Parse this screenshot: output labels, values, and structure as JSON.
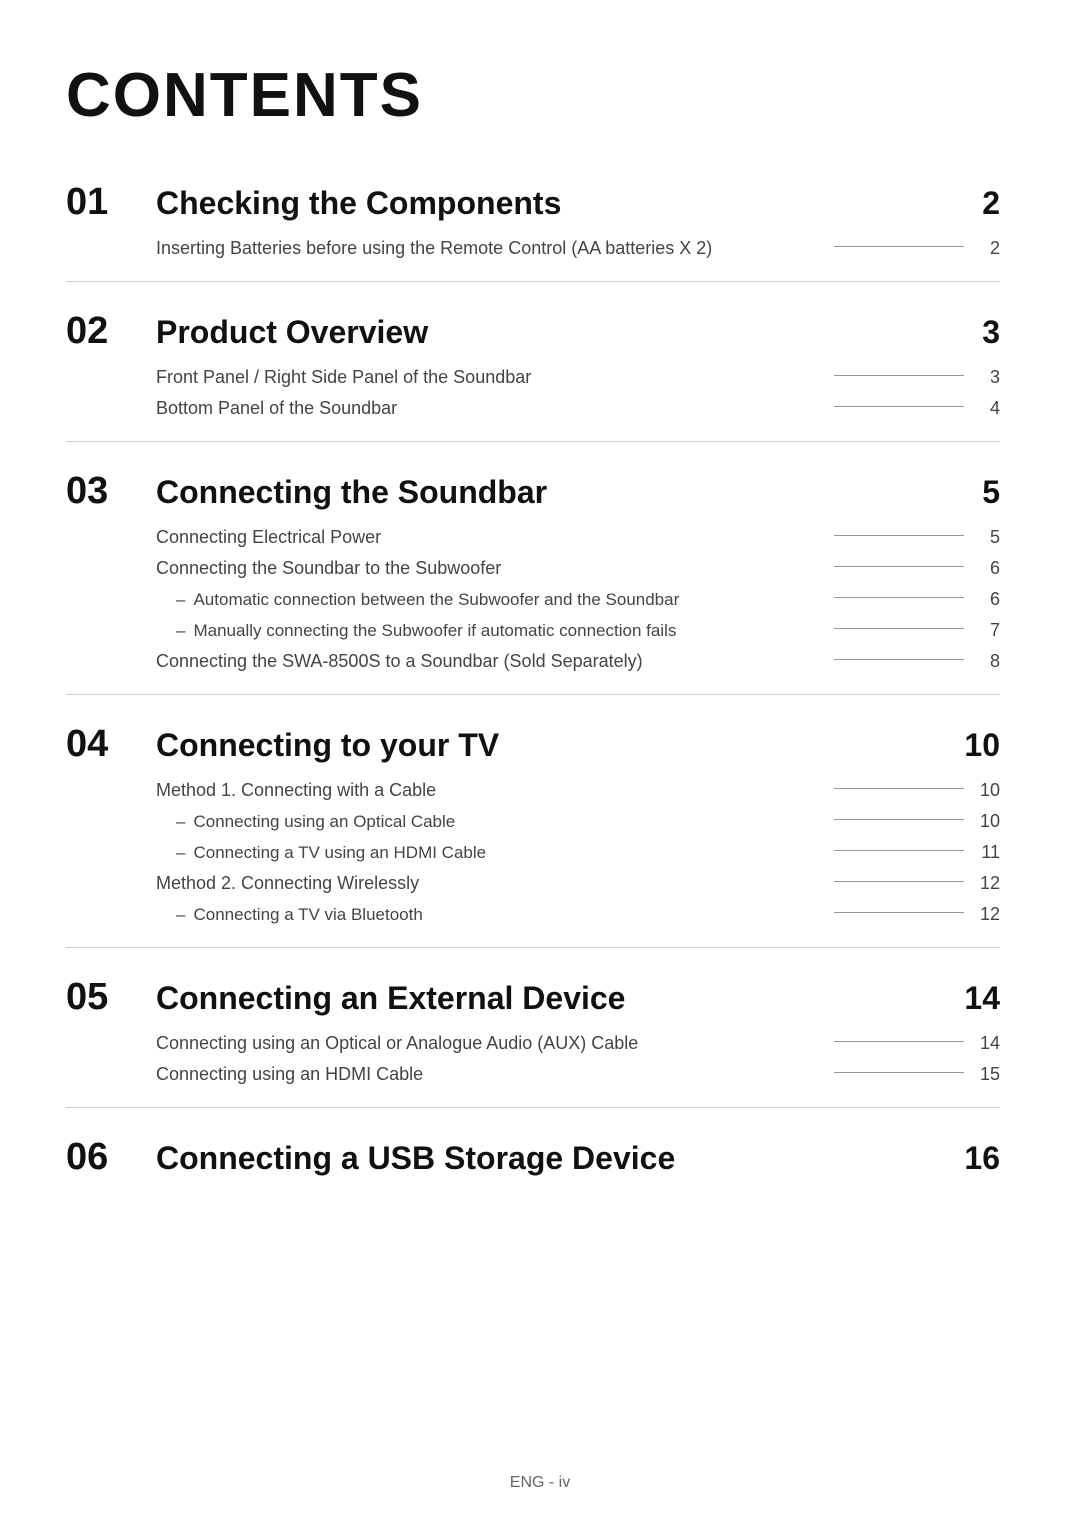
{
  "page": {
    "title": "CONTENTS",
    "footer": "ENG - iv"
  },
  "sections": [
    {
      "id": "01",
      "title": "Checking the Components",
      "page": "2",
      "items": [
        {
          "text": "Inserting Batteries before using the Remote Control (AA batteries X 2)",
          "page": "2",
          "sub": false
        }
      ]
    },
    {
      "id": "02",
      "title": "Product Overview",
      "page": "3",
      "items": [
        {
          "text": "Front Panel / Right Side Panel of the Soundbar",
          "page": "3",
          "sub": false
        },
        {
          "text": "Bottom Panel of the Soundbar",
          "page": "4",
          "sub": false
        }
      ]
    },
    {
      "id": "03",
      "title": "Connecting the Soundbar",
      "page": "5",
      "items": [
        {
          "text": "Connecting Electrical Power",
          "page": "5",
          "sub": false
        },
        {
          "text": "Connecting the Soundbar to the Subwoofer",
          "page": "6",
          "sub": false
        },
        {
          "text": "Automatic connection between the Subwoofer and the Soundbar",
          "page": "6",
          "sub": true
        },
        {
          "text": "Manually connecting the Subwoofer if automatic connection fails",
          "page": "7",
          "sub": true
        },
        {
          "text": "Connecting the SWA-8500S to a Soundbar (Sold Separately)",
          "page": "8",
          "sub": false
        }
      ]
    },
    {
      "id": "04",
      "title": "Connecting to your TV",
      "page": "10",
      "items": [
        {
          "text": "Method 1. Connecting with a Cable",
          "page": "10",
          "sub": false
        },
        {
          "text": "Connecting using an Optical Cable",
          "page": "10",
          "sub": true
        },
        {
          "text": "Connecting a TV using an HDMI Cable",
          "page": "11",
          "sub": true
        },
        {
          "text": "Method 2. Connecting Wirelessly",
          "page": "12",
          "sub": false
        },
        {
          "text": "Connecting a TV via Bluetooth",
          "page": "12",
          "sub": true
        }
      ]
    },
    {
      "id": "05",
      "title": "Connecting an External Device",
      "page": "14",
      "items": [
        {
          "text": "Connecting using an Optical or Analogue Audio (AUX) Cable",
          "page": "14",
          "sub": false
        },
        {
          "text": "Connecting using an HDMI Cable",
          "page": "15",
          "sub": false
        }
      ]
    },
    {
      "id": "06",
      "title": "Connecting a USB Storage Device",
      "page": "16",
      "items": []
    }
  ]
}
